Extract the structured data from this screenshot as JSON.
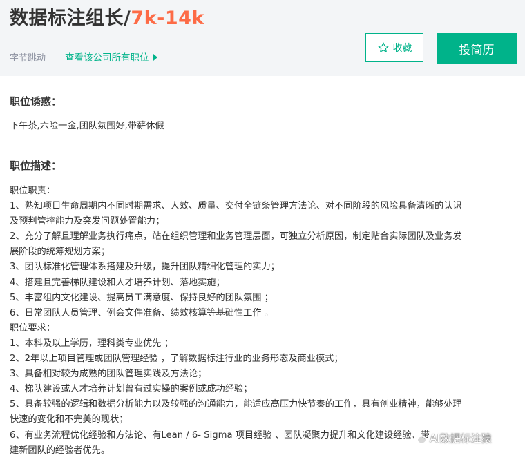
{
  "header": {
    "title": "数据标注组长/",
    "salary": "7k-14k",
    "company": "字节跳动",
    "company_link": "查看该公司所有职位",
    "favorite_label": "收藏",
    "apply_label": "投简历"
  },
  "perks": {
    "heading": "职位诱惑：",
    "text": "下午茶,六险一金,团队氛围好,带薪休假"
  },
  "description": {
    "heading": "职位描述：",
    "lines": [
      "职位职责：",
      "1、熟知项目生命周期内不同时期需求、人效、质量、交付全链条管理方法论、对不同阶段的风险具备清晰的认识",
      "及预判管控能力及突发问题处置能力；",
      "2、充分了解且理解业务执行痛点，站在组织管理和业务管理层面，可独立分析原因，制定贴合实际团队及业务发",
      "展阶段的统筹规划方案；",
      "3、团队标准化管理体系搭建及升级，提升团队精细化管理的实力；",
      "4、搭建且完善梯队建设和人才培养计划、落地实施；",
      "5、丰富组内文化建设、提高员工满意度、保持良好的团队氛围 ；",
      "6、日常团队人员管理、例会文件准备、绩效核算等基础性工作 。",
      "职位要求：",
      "1、本科及以上学历，理科类专业优先 ；",
      "2、2年以上项目管理或团队管理经验 ，了解数据标注行业的业务形态及商业模式；",
      "3、具备相对较为成熟的团队管理实践及方法论；",
      "4、梯队建设或人才培养计划曾有过实操的案例或成功经验；",
      "5、具备较强的逻辑和数据分析能力以及较强的沟通能力，能适应高压力快节奏的工作，具有创业精神，能够处理",
      "快速的变化和不完美的现状；",
      "6、有业务流程优化经验和方法论、有Lean / 6- Sigma 项目经验 、团队凝聚力提升和文化建设经验、带",
      "建新团队的经验者优先。"
    ]
  },
  "watermark": {
    "text": "AI数据标注猿"
  },
  "colors": {
    "accent": "#00b38a",
    "salary": "#fd6b46",
    "header_bg": "#f3f5f7"
  }
}
